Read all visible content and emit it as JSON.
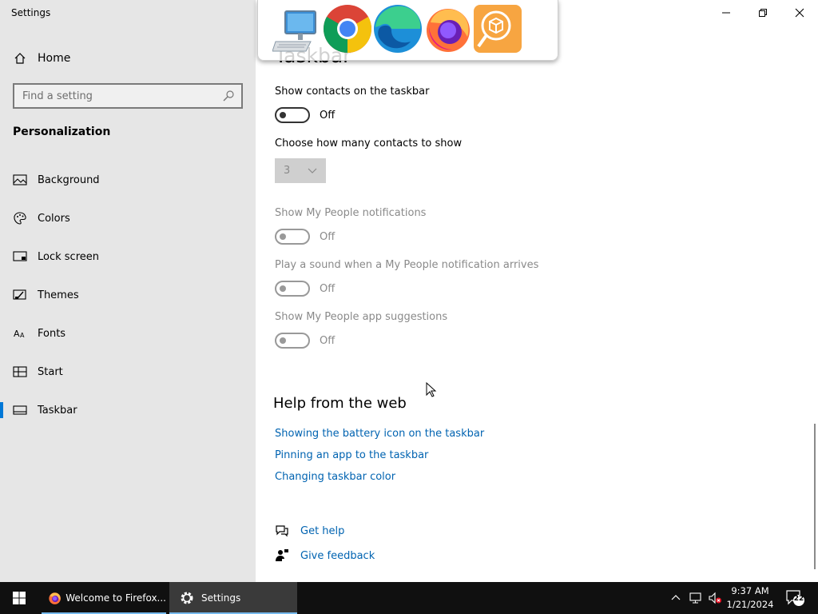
{
  "window": {
    "title": "Settings"
  },
  "sidebar": {
    "home_label": "Home",
    "search_placeholder": "Find a setting",
    "section_title": "Personalization",
    "items": [
      {
        "label": "Background",
        "icon": "picture-icon"
      },
      {
        "label": "Colors",
        "icon": "palette-icon"
      },
      {
        "label": "Lock screen",
        "icon": "lock-screen-icon"
      },
      {
        "label": "Themes",
        "icon": "themes-icon"
      },
      {
        "label": "Fonts",
        "icon": "fonts-icon"
      },
      {
        "label": "Start",
        "icon": "start-icon"
      },
      {
        "label": "Taskbar",
        "icon": "taskbar-icon",
        "active": true
      }
    ]
  },
  "main": {
    "page_title": "Taskbar",
    "show_contacts": {
      "label": "Show contacts on the taskbar",
      "state": "Off"
    },
    "contacts_count": {
      "label": "Choose how many contacts to show",
      "value": "3"
    },
    "people_notifications": {
      "label": "Show My People notifications",
      "state": "Off"
    },
    "play_sound": {
      "label": "Play a sound when a My People notification arrives",
      "state": "Off"
    },
    "app_suggestions": {
      "label": "Show My People app suggestions",
      "state": "Off"
    },
    "help": {
      "title": "Help from the web",
      "links": [
        "Showing the battery icon on the taskbar",
        "Pinning an app to the taskbar",
        "Changing taskbar color"
      ],
      "get_help": "Get help",
      "give_feedback": "Give feedback"
    }
  },
  "dock": {
    "icons": [
      "computer-icon",
      "chrome-icon",
      "edge-icon",
      "firefox-icon",
      "package-search-icon"
    ]
  },
  "taskbar": {
    "buttons": [
      {
        "label": "Welcome to Firefox...",
        "icon": "firefox-icon"
      },
      {
        "label": "Settings",
        "icon": "gear-icon",
        "active": true
      }
    ],
    "clock": {
      "time": "9:37 AM",
      "date": "1/21/2024"
    },
    "notification_count": "22"
  },
  "colors": {
    "accent": "#0078d7",
    "link": "#0063b1",
    "sidebar_bg": "#e6e6e6",
    "taskbar_bg": "#101010"
  }
}
